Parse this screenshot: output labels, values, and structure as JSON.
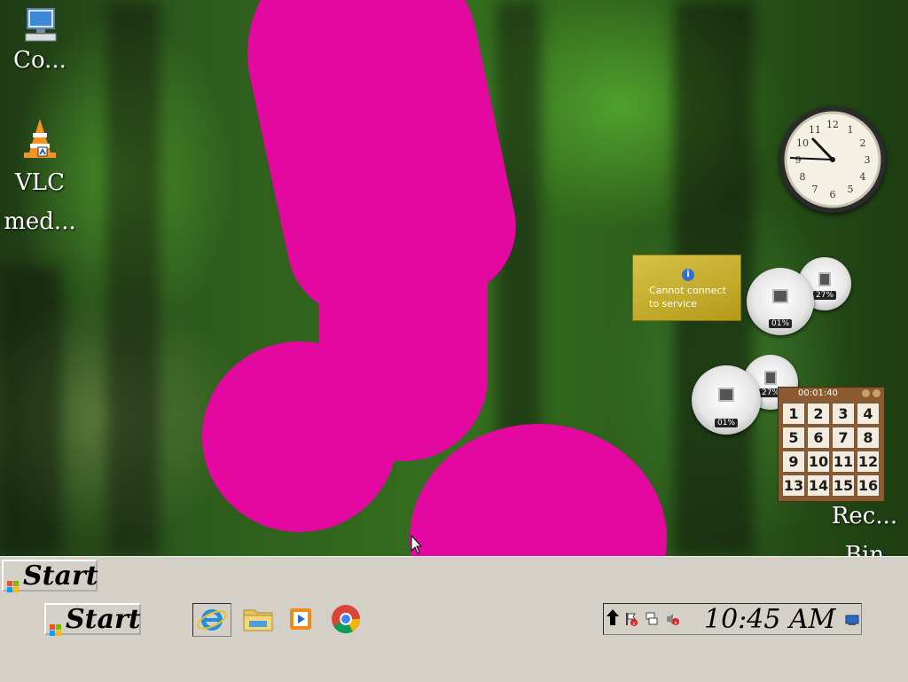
{
  "desktop": {
    "icons": [
      {
        "label": "Co...",
        "icon": "computer-icon"
      },
      {
        "label": "VLC\nmed...",
        "icon": "vlc-icon"
      },
      {
        "label": "Rec...\nBin",
        "icon": "recycle-bin-icon"
      }
    ]
  },
  "gadgets": {
    "weather": {
      "message": "Cannot connect\nto service",
      "icon": "info-icon"
    },
    "cpu_meter_1": {
      "cpu": "01%",
      "memory": "27%"
    },
    "cpu_meter_2": {
      "cpu": "01%",
      "memory": "27%"
    },
    "clock": {
      "time": "10:45",
      "numerals": [
        "12",
        "1",
        "2",
        "3",
        "4",
        "5",
        "6",
        "7",
        "8",
        "9",
        "10",
        "11"
      ]
    },
    "puzzle": {
      "timer": "00:01:40",
      "tiles": [
        "1",
        "2",
        "3",
        "4",
        "5",
        "6",
        "7",
        "8",
        "9",
        "10",
        "11",
        "12",
        "13",
        "14",
        "15",
        "16"
      ]
    }
  },
  "taskbar": {
    "start_label": "Start",
    "quicklaunch": [
      {
        "name": "Internet Explorer",
        "icon": "internet-explorer-icon"
      },
      {
        "name": "File Explorer",
        "icon": "folder-icon"
      },
      {
        "name": "Media Player",
        "icon": "media-player-icon"
      },
      {
        "name": "Google Chrome",
        "icon": "chrome-icon"
      }
    ],
    "tray": {
      "time": "10:45 AM",
      "icons": [
        "show-hidden-icon",
        "action-center-icon",
        "network-icon",
        "volume-muted-icon",
        "show-desktop-icon"
      ]
    }
  },
  "colors": {
    "taskbar_bg": "#d4d0c8",
    "wallpaper_accent": "#e3089f",
    "weather_gadget": "#c9b33a"
  }
}
